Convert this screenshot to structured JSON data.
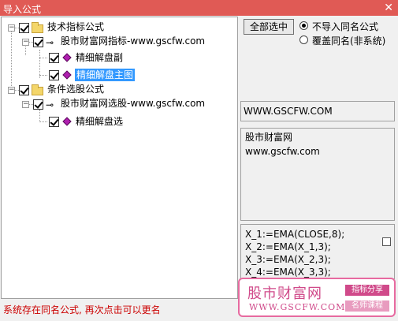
{
  "window": {
    "title": "导入公式",
    "close_glyph": "✕"
  },
  "tree": {
    "categories": [
      {
        "label": "技术指标公式",
        "package": "股市财富网指标-www.gscfw.com",
        "items": [
          "精细解盘副",
          "精细解盘主图"
        ],
        "selected_item": "精细解盘主图"
      },
      {
        "label": "条件选股公式",
        "package": "股市财富网选股-www.gscfw.com",
        "items": [
          "精细解盘选"
        ]
      }
    ]
  },
  "actions": {
    "select_all_label": "全部选中"
  },
  "options": [
    {
      "label": "不导入同名公式",
      "selected": true
    },
    {
      "label": "覆盖同名(非系统)",
      "selected": false
    }
  ],
  "info": {
    "url": "WWW.GSCFW.COM",
    "description_lines": [
      "股市财富网",
      "www.gscfw.com"
    ]
  },
  "formula_lines": [
    "X_1:=EMA(CLOSE,8);",
    "X_2:=EMA(X_1,3);",
    "X_3:=EMA(X_2,3);",
    "X_4:=EMA(X_3,3);"
  ],
  "status": "系统存在同名公式, 再次点击可以更名",
  "watermark": {
    "brand": "股市财富网",
    "url": "WWW.GSCFW.COM",
    "tag1": "指标分享",
    "tag2": "名师课程"
  },
  "colors": {
    "titlebar": "#e05a55",
    "selection": "#3399ff",
    "status_text": "#cc0000",
    "watermark": "#d04a8a"
  }
}
